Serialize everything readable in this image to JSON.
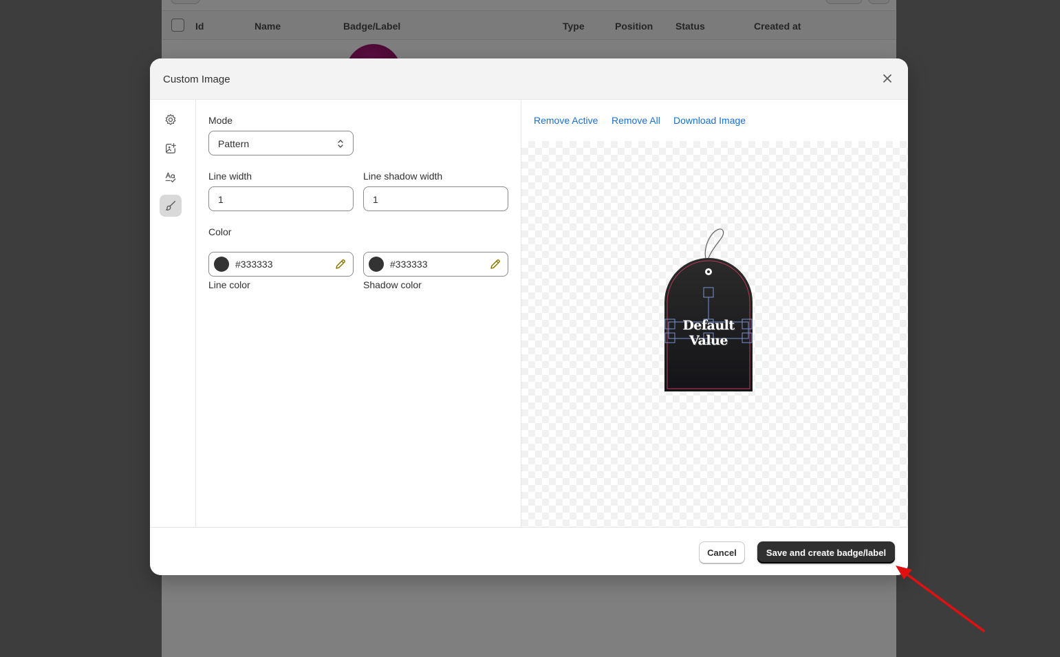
{
  "background_table": {
    "columns": [
      "Id",
      "Name",
      "Badge/Label",
      "Type",
      "Position",
      "Status",
      "Created at"
    ]
  },
  "modal": {
    "title": "Custom Image",
    "close_icon": "close-icon",
    "rail_icons": [
      "gear-icon",
      "image-add-icon",
      "text-check-icon",
      "brush-icon"
    ],
    "form": {
      "mode_label": "Mode",
      "mode_value": "Pattern",
      "line_width_label": "Line width",
      "line_width_value": "1",
      "line_shadow_width_label": "Line shadow width",
      "line_shadow_width_value": "1",
      "color_heading": "Color",
      "line_color_value": "#333333",
      "line_color_label": "Line color",
      "shadow_color_value": "#333333",
      "shadow_color_label": "Shadow color"
    },
    "preview": {
      "remove_active": "Remove Active",
      "remove_all": "Remove All",
      "download_image": "Download Image",
      "tag_text": "Default Value"
    },
    "footer": {
      "cancel": "Cancel",
      "save": "Save and create badge/label"
    }
  },
  "colors": {
    "swatch": "#333333",
    "link": "#1a6fd1",
    "primary_button": "#303030",
    "pencil": "#8a7a00",
    "arrow": "#e01010"
  }
}
